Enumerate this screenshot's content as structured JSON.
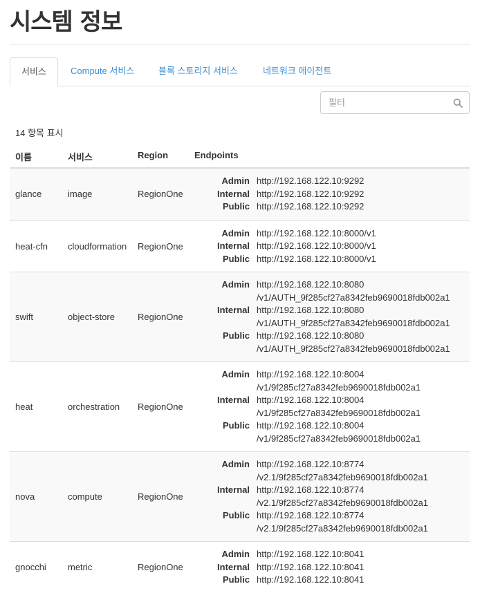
{
  "page": {
    "title": "시스템 정보"
  },
  "tabs": [
    {
      "label": "서비스",
      "active": true
    },
    {
      "label": "Compute 서비스",
      "active": false
    },
    {
      "label": "블록 스토리지 서비스",
      "active": false
    },
    {
      "label": "네트워크 에이전트",
      "active": false
    }
  ],
  "filter": {
    "placeholder": "필터",
    "value": "",
    "icon": "search-icon"
  },
  "table": {
    "count_text": "14 항목 표시",
    "headers": [
      "이름",
      "서비스",
      "Region",
      "Endpoints"
    ],
    "rows": [
      {
        "name": "glance",
        "service": "image",
        "region": "RegionOne",
        "endpoints": [
          {
            "type": "Admin",
            "lines": [
              "http://192.168.122.10:9292"
            ]
          },
          {
            "type": "Internal",
            "lines": [
              "http://192.168.122.10:9292"
            ]
          },
          {
            "type": "Public",
            "lines": [
              "http://192.168.122.10:9292"
            ]
          }
        ]
      },
      {
        "name": "heat-cfn",
        "service": "cloudformation",
        "region": "RegionOne",
        "endpoints": [
          {
            "type": "Admin",
            "lines": [
              "http://192.168.122.10:8000/v1"
            ]
          },
          {
            "type": "Internal",
            "lines": [
              "http://192.168.122.10:8000/v1"
            ]
          },
          {
            "type": "Public",
            "lines": [
              "http://192.168.122.10:8000/v1"
            ]
          }
        ]
      },
      {
        "name": "swift",
        "service": "object-store",
        "region": "RegionOne",
        "endpoints": [
          {
            "type": "Admin",
            "lines": [
              "http://192.168.122.10:8080",
              "/v1/AUTH_9f285cf27a8342feb9690018fdb002a1"
            ]
          },
          {
            "type": "Internal",
            "lines": [
              "http://192.168.122.10:8080",
              "/v1/AUTH_9f285cf27a8342feb9690018fdb002a1"
            ]
          },
          {
            "type": "Public",
            "lines": [
              "http://192.168.122.10:8080",
              "/v1/AUTH_9f285cf27a8342feb9690018fdb002a1"
            ]
          }
        ]
      },
      {
        "name": "heat",
        "service": "orchestration",
        "region": "RegionOne",
        "endpoints": [
          {
            "type": "Admin",
            "lines": [
              "http://192.168.122.10:8004",
              "/v1/9f285cf27a8342feb9690018fdb002a1"
            ]
          },
          {
            "type": "Internal",
            "lines": [
              "http://192.168.122.10:8004",
              "/v1/9f285cf27a8342feb9690018fdb002a1"
            ]
          },
          {
            "type": "Public",
            "lines": [
              "http://192.168.122.10:8004",
              "/v1/9f285cf27a8342feb9690018fdb002a1"
            ]
          }
        ]
      },
      {
        "name": "nova",
        "service": "compute",
        "region": "RegionOne",
        "endpoints": [
          {
            "type": "Admin",
            "lines": [
              "http://192.168.122.10:8774",
              "/v2.1/9f285cf27a8342feb9690018fdb002a1"
            ]
          },
          {
            "type": "Internal",
            "lines": [
              "http://192.168.122.10:8774",
              "/v2.1/9f285cf27a8342feb9690018fdb002a1"
            ]
          },
          {
            "type": "Public",
            "lines": [
              "http://192.168.122.10:8774",
              "/v2.1/9f285cf27a8342feb9690018fdb002a1"
            ]
          }
        ]
      },
      {
        "name": "gnocchi",
        "service": "metric",
        "region": "RegionOne",
        "endpoints": [
          {
            "type": "Admin",
            "lines": [
              "http://192.168.122.10:8041"
            ]
          },
          {
            "type": "Internal",
            "lines": [
              "http://192.168.122.10:8041"
            ]
          },
          {
            "type": "Public",
            "lines": [
              "http://192.168.122.10:8041"
            ]
          }
        ]
      }
    ]
  },
  "colors": {
    "link": "#3b8fd6",
    "text": "#333333",
    "stripe": "#f9f9f9",
    "border": "#dddddd"
  }
}
